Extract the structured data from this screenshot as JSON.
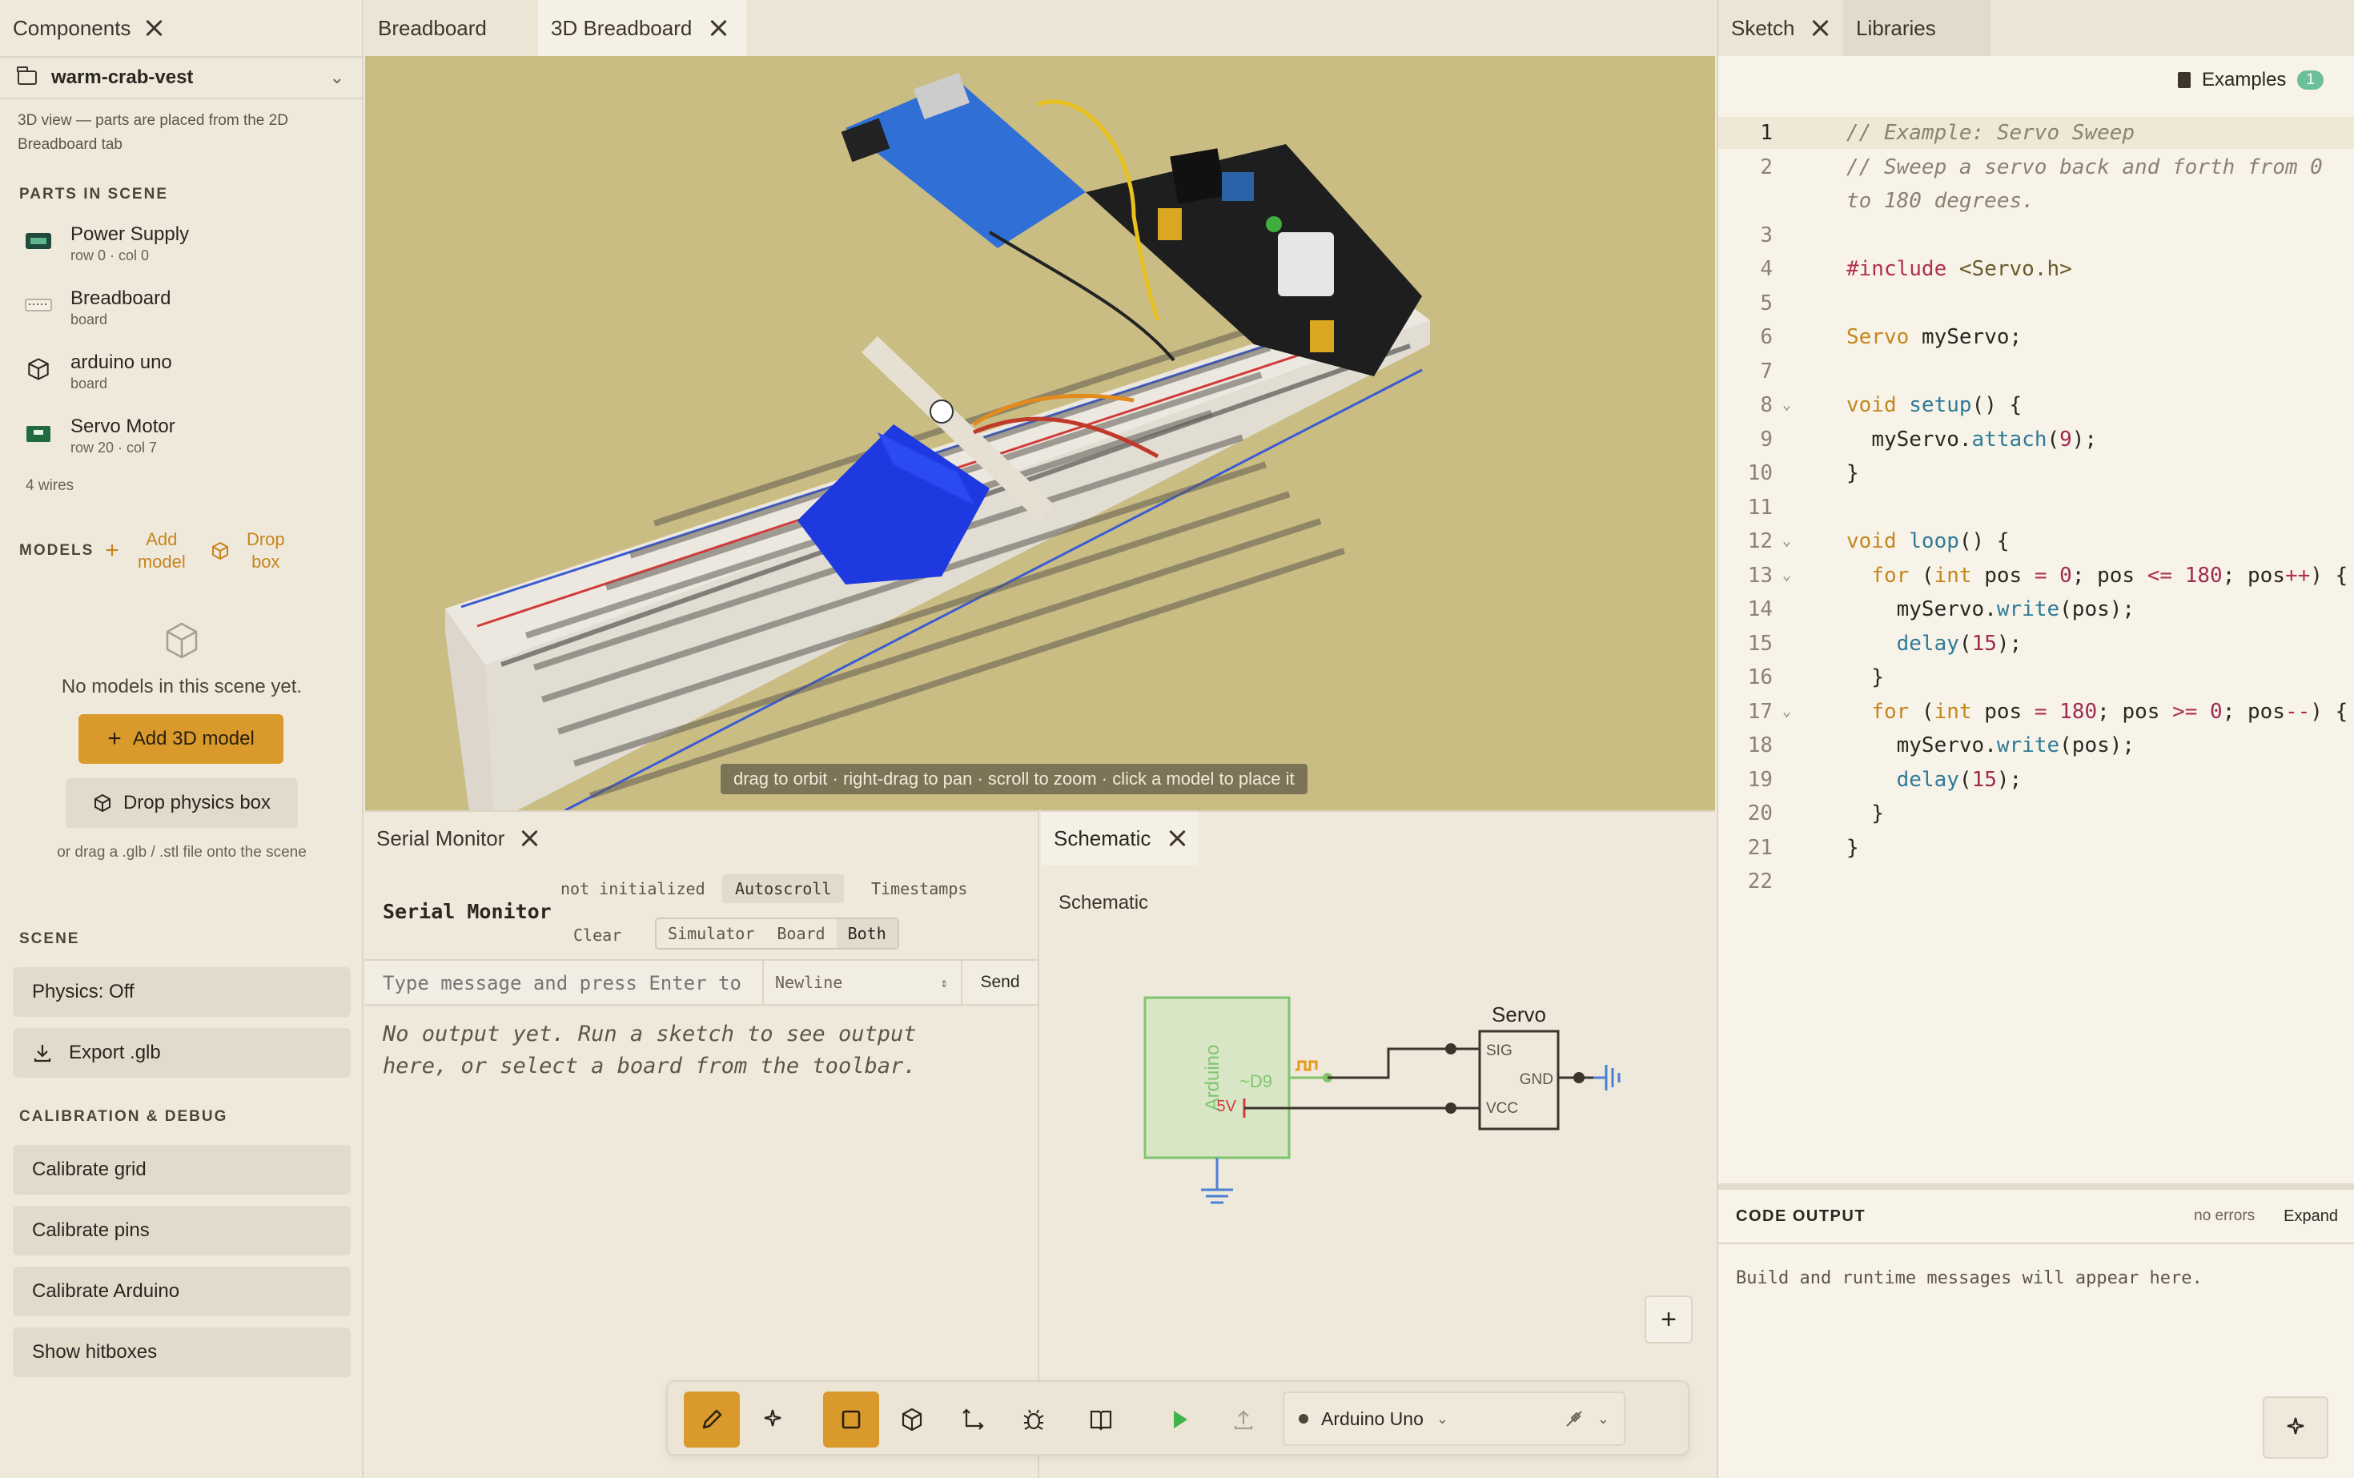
{
  "left_panel": {
    "tab_label": "Components",
    "project_name": "warm-crab-vest",
    "hint": "3D view — parts are placed from the 2D Breadboard tab",
    "parts_title": "PARTS IN SCENE",
    "parts": [
      {
        "name": "Power Supply",
        "sub": "row 0 · col 0",
        "icon": "power-supply-icon"
      },
      {
        "name": "Breadboard",
        "sub": "board",
        "icon": "breadboard-icon"
      },
      {
        "name": "arduino uno",
        "sub": "board",
        "icon": "cube-icon"
      },
      {
        "name": "Servo Motor",
        "sub": "row 20 · col 7",
        "icon": "servo-icon"
      }
    ],
    "wires": "4 wires",
    "models_label": "MODELS",
    "add_model": "Add model",
    "drop_box": "Drop box",
    "empty_text": "No models in this scene yet.",
    "add_3d_model": "Add 3D model",
    "drop_physics_box": "Drop physics box",
    "drag_hint": "or drag a .glb / .stl file onto the scene",
    "scene_title": "SCENE",
    "physics": "Physics: Off",
    "export": "Export .glb",
    "calib_title": "CALIBRATION & DEBUG",
    "calib_buttons": [
      "Calibrate grid",
      "Calibrate pins",
      "Calibrate Arduino",
      "Show hitboxes"
    ]
  },
  "center": {
    "tabs": [
      "Breadboard",
      "3D Breadboard"
    ],
    "viewport_hint": "drag to orbit · right-drag to pan · scroll to zoom · click a model to place it"
  },
  "serial": {
    "tab_label": "Serial Monitor",
    "heading": "Serial Monitor",
    "status": "not initialized",
    "autoscroll": "Autoscroll",
    "timestamps": "Timestamps",
    "clear": "Clear",
    "modes": [
      "Simulator",
      "Board",
      "Both"
    ],
    "active_mode": "Both",
    "input_placeholder": "Type message and press Enter to send",
    "line_ending": "Newline",
    "send": "Send",
    "empty": "No output yet. Run a sketch to see output here, or select a board from the toolbar."
  },
  "schematic": {
    "tab_label": "Schematic",
    "label": "Schematic",
    "arduino_label": "Arduino",
    "pin_label": "~D9",
    "servo_label": "Servo",
    "sig": "SIG",
    "gnd": "GND",
    "vcc": "VCC",
    "vlabel": "5V",
    "zoom_in": "+"
  },
  "toolbar": {
    "board": "Arduino Uno",
    "accent": "#d99a2b"
  },
  "right_panel": {
    "tabs": [
      "Sketch",
      "Libraries"
    ],
    "examples": "Examples",
    "examples_count": "1",
    "code_output_title": "CODE OUTPUT",
    "no_errors": "no errors",
    "expand": "Expand",
    "output_msg": "Build and runtime messages will appear here."
  },
  "code": {
    "active_line": 1,
    "lines": [
      "// Example: Servo Sweep",
      "// Sweep a servo back and forth from 0",
      "to 180 degrees.",
      "",
      "#include <Servo.h>",
      "",
      "Servo myServo;",
      "",
      "void setup() {",
      "  myServo.attach(9);",
      "}",
      "",
      "void loop() {",
      "  for (int pos = 0; pos <= 180; pos++) {",
      "    myServo.write(pos);",
      "    delay(15);",
      "  }",
      "  for (int pos = 180; pos >= 0; pos--) {",
      "    myServo.write(pos);",
      "    delay(15);",
      "  }",
      "}",
      ""
    ],
    "line_numbers": [
      "1",
      "2",
      "",
      "3",
      "4",
      "5",
      "6",
      "7",
      "8",
      "9",
      "10",
      "11",
      "12",
      "13",
      "14",
      "15",
      "16",
      "17",
      "18",
      "19",
      "20",
      "21",
      "22"
    ]
  }
}
